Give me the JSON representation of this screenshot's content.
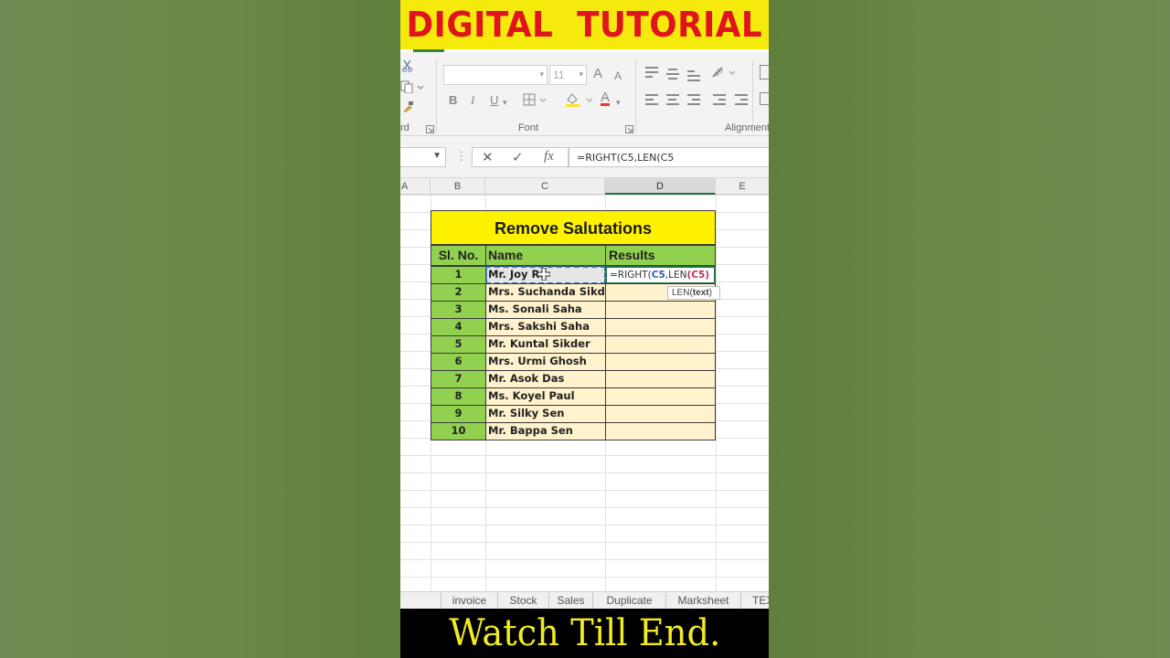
{
  "banner": {
    "title": "DIGITAL  TUTORIAL"
  },
  "ribbon": {
    "font_size": "11",
    "bold": "B",
    "italic": "I",
    "underline": "U",
    "grow_font": "A",
    "shrink_font": "A",
    "font_color": "A",
    "clipboard_label": "rd",
    "font_group_label": "Font",
    "alignment_group_label": "Alignment"
  },
  "formula_bar": {
    "cancel": "✕",
    "enter": "✓",
    "fx": "fx",
    "formula": "=RIGHT(C5,LEN(C5"
  },
  "columns": [
    "A",
    "B",
    "C",
    "D",
    "E"
  ],
  "table": {
    "title": "Remove Salutations",
    "headers": {
      "sl": "Sl. No.",
      "name": "Name",
      "results": "Results"
    },
    "rows": [
      {
        "sl": "1",
        "name": "Mr. Joy Ro"
      },
      {
        "sl": "2",
        "name": "Mrs. Suchanda Sikder"
      },
      {
        "sl": "3",
        "name": "Ms. Sonali Saha"
      },
      {
        "sl": "4",
        "name": "Mrs. Sakshi Saha"
      },
      {
        "sl": "5",
        "name": "Mr. Kuntal Sikder"
      },
      {
        "sl": "6",
        "name": "Mrs. Urmi Ghosh"
      },
      {
        "sl": "7",
        "name": "Mr. Asok Das"
      },
      {
        "sl": "8",
        "name": "Ms. Koyel Paul"
      },
      {
        "sl": "9",
        "name": "Mr. Silky Sen"
      },
      {
        "sl": "10",
        "name": "Mr. Bappa Sen"
      }
    ],
    "active_formula": {
      "prefix": "=RIGHT(",
      "ref1": "C5",
      "mid": ",LEN",
      "paren_open": "(",
      "ref2": "C5",
      "paren_close": ")"
    },
    "tooltip": {
      "fn": "LEN(",
      "arg": "text",
      "close": ")"
    }
  },
  "sheet_tabs": [
    "invoice",
    "Stock",
    "Sales",
    "Duplicate",
    "Marksheet",
    "TEX"
  ],
  "caption": "Watch Till End.",
  "colors": {
    "banner_bg": "#f6ea0d",
    "banner_text": "#e0141d",
    "title_bg": "#fff200",
    "header_bg": "#92d050",
    "cell_bg": "#fff2cc",
    "caption_text": "#f1ea26"
  }
}
